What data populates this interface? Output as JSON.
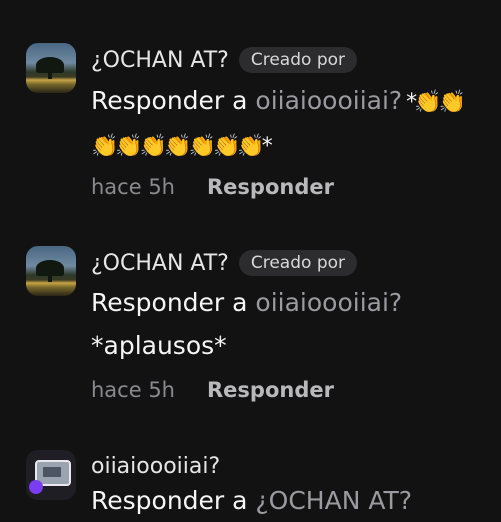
{
  "comments": [
    {
      "username": "¿OCHAN AT?",
      "badge": "Creado por",
      "reply_prefix": "Responder a ",
      "reply_to": "oiiaioooiiai?",
      "line1_suffix": " *👏👏",
      "line2": "👏👏👏👏👏👏👏*",
      "time": "hace 5h",
      "reply_label": "Responder"
    },
    {
      "username": "¿OCHAN AT?",
      "badge": "Creado por",
      "reply_prefix": "Responder a ",
      "reply_to": "oiiaioooiiai?",
      "line2": "*aplausos*",
      "time": "hace 5h",
      "reply_label": "Responder"
    },
    {
      "username": "oiiaioooiiai?",
      "reply_prefix": "Responder a ",
      "reply_to": "¿OCHAN AT?"
    }
  ]
}
